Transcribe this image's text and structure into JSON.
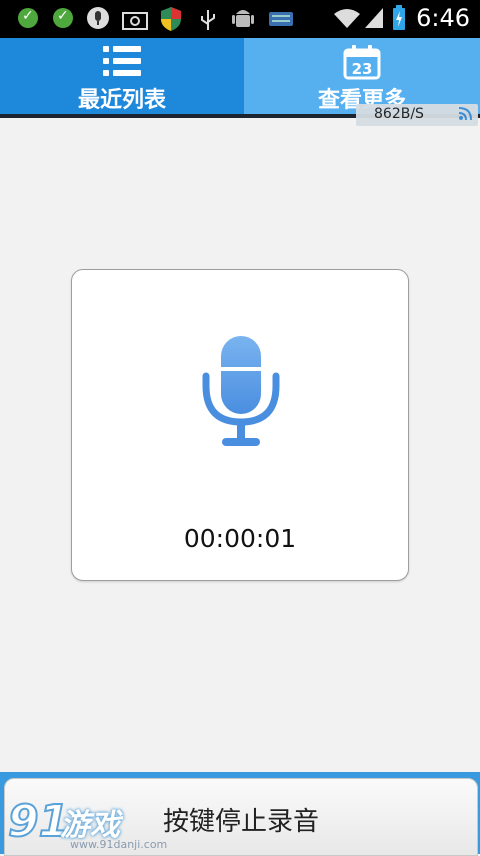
{
  "status_bar": {
    "time": "6:46",
    "icons": [
      "check-icon",
      "check-icon",
      "mic-notify-icon",
      "photo-icon",
      "shield-icon",
      "usb-icon",
      "android-icon",
      "battery-small-icon",
      "wifi-icon",
      "signal-icon",
      "battery-charging-icon"
    ]
  },
  "tabs": [
    {
      "label": "最近列表",
      "icon": "list-icon"
    },
    {
      "label": "查看更多",
      "icon": "calendar-icon",
      "icon_text": "23"
    }
  ],
  "speed_badge": {
    "text": "862B/S"
  },
  "recorder": {
    "timer": "00:00:01"
  },
  "bottom_button": {
    "label": "按键停止录音"
  },
  "watermark": {
    "brand": "游戏",
    "number": "91",
    "url": "www.91danji.com"
  },
  "colors": {
    "accent": "#1e88db",
    "accent_light": "#56b0f0",
    "mic": "#4a90e2"
  }
}
